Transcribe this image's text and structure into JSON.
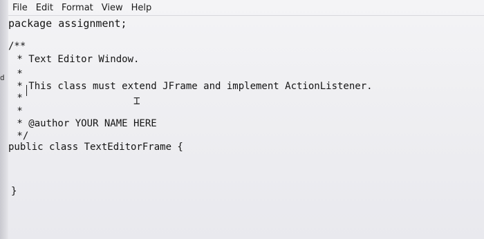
{
  "menu": {
    "file": "File",
    "edit": "Edit",
    "format": "Format",
    "view": "View",
    "help": "Help"
  },
  "editor": {
    "lines": {
      "l1": "package assignment;",
      "l2": "/**",
      "l3": " * Text Editor Window.",
      "l4": " *",
      "l5": " * This class must extend JFrame and implement ActionListener.",
      "l6": " *",
      "l7": " *",
      "l8": " * @author YOUR NAME HERE",
      "l9": " */",
      "l10": "public class TextEditorFrame {",
      "l11": "}"
    },
    "gutter_mark": "d"
  }
}
